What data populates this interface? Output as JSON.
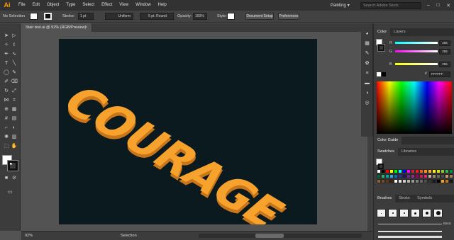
{
  "app": {
    "logo": "Ai"
  },
  "menubar": {
    "items": [
      "File",
      "Edit",
      "Object",
      "Type",
      "Select",
      "Effect",
      "View",
      "Window",
      "Help"
    ],
    "workspace": "Painting",
    "search_placeholder": "Search Adobe Stock",
    "window_controls": [
      "–",
      "□",
      "✕"
    ]
  },
  "controlbar": {
    "selection_label": "No Selection",
    "stroke_label": "Stroke:",
    "stroke_weight": "1 pt",
    "profile": "Uniform",
    "brush": "5 pt. Round",
    "opacity_label": "Opacity:",
    "opacity_value": "100%",
    "style_label": "Style:",
    "document_setup": "Document Setup",
    "preferences": "Preferences"
  },
  "document": {
    "tab_title": "Stair text.ai @ 92% (RGB/Preview)",
    "close": "×",
    "artwork_text": "COURAGE",
    "artboard_color": "#0b1a1f",
    "text_color": "#f6a22c",
    "text_shadow_color": "#c9761a"
  },
  "status": {
    "zoom": "92%",
    "tool": "Selection"
  },
  "panels": {
    "color_tabs": [
      "Color",
      "Layers"
    ],
    "sliders": [
      {
        "label": "R",
        "value": "255"
      },
      {
        "label": "G",
        "value": "255"
      },
      {
        "label": "B",
        "value": "255"
      }
    ],
    "hex_prefix": "#",
    "hex_value": "FFFFFF",
    "color_guide_tab": "Color Guide",
    "swatch_tabs": [
      "Swatches",
      "Libraries"
    ],
    "brush_tabs": [
      "Brushes",
      "Stroke",
      "Symbols"
    ],
    "basic_label": "Basic",
    "swatch_colors": [
      "#ffffff",
      "#000000",
      "#ff0000",
      "#ffff00",
      "#00ff00",
      "#00ffff",
      "#0000ff",
      "#ff00ff",
      "#c1272d",
      "#ed1c24",
      "#f15a24",
      "#f7931e",
      "#fbb03b",
      "#fcee21",
      "#d9e021",
      "#8cc63f",
      "#39b54a",
      "#009245",
      "#006837",
      "#22b573",
      "#00a99d",
      "#29abe2",
      "#0071bc",
      "#2e3192",
      "#1b1464",
      "#662d91",
      "#93278f",
      "#9e005d",
      "#d4145a",
      "#ed1e79",
      "#c7b299",
      "#998675",
      "#736357",
      "#534741",
      "#c69c6d",
      "#a67c52",
      "#8c6239",
      "#754c24",
      "#603813",
      "#42210b",
      "#ffffff",
      "#e6e6e6",
      "#cccccc",
      "#b3b3b3",
      "#999999",
      "#808080",
      "#666666",
      "#4d4d4d",
      "#333333",
      "#1a1a1a",
      "#000000",
      "#f6a22c",
      "#c9761a",
      "#0b1a1f"
    ]
  }
}
